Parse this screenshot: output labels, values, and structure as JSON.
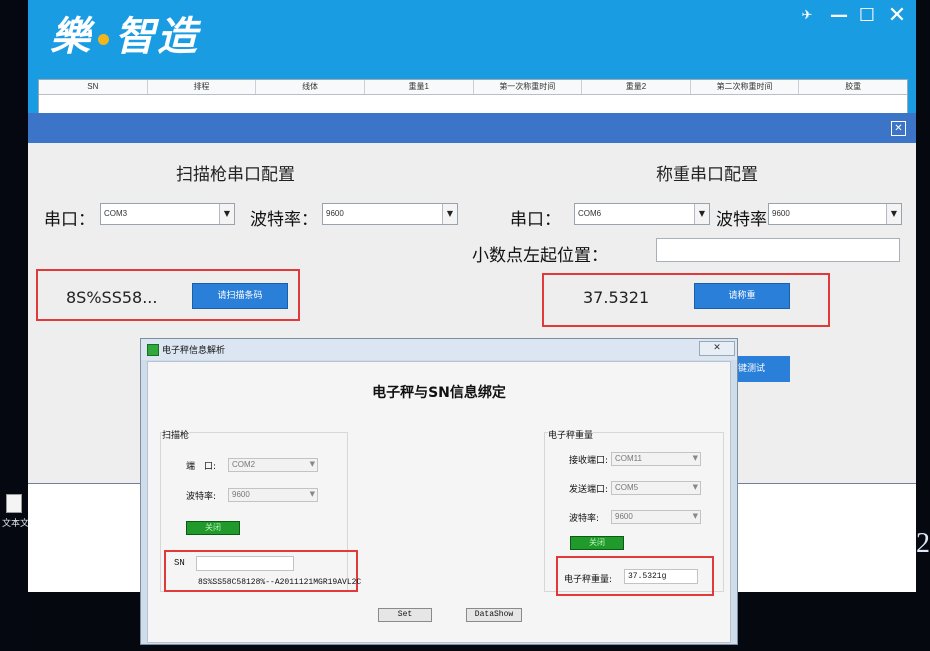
{
  "app": {
    "logo_text_left": "樂",
    "logo_text_right": "智造",
    "window_controls": {
      "pin": "✈",
      "minimize": "—",
      "maximize": "☐",
      "close": "✕"
    }
  },
  "grid": {
    "columns": [
      "SN",
      "排程",
      "线体",
      "重量1",
      "第一次称重时间",
      "重量2",
      "第二次称重时间",
      "胶重"
    ]
  },
  "config": {
    "close_glyph": "✕",
    "scanner": {
      "title": "扫描枪串口配置",
      "port_label": "串口：",
      "port_value": "COM3",
      "baud_label": "波特率：",
      "baud_value": "9600",
      "scan_value": "8S%SS58...",
      "scan_button": "请扫描条码"
    },
    "scale": {
      "title": "称重串口配置",
      "port_label": "串口：",
      "port_value": "COM6",
      "baud_label": "波特率：",
      "baud_value": "9600",
      "decimal_label": "小数点左起位置：",
      "decimal_value": "",
      "weight_value": "37.5321",
      "weigh_button": "请称重"
    },
    "behind_button_fragment": "键测试"
  },
  "dialog": {
    "title": "电子秤信息解析",
    "close_glyph": "✕",
    "heading": "电子秤与SN信息绑定",
    "scanner_group": {
      "title": "扫描枪",
      "port_label": "端　口:",
      "port_value": "COM2",
      "baud_label": "波特率:",
      "baud_value": "9600",
      "toggle_button": "关闭",
      "sn_label": "SN",
      "sn_input": "",
      "sn_value": "8S%SS58C58128%--A2011121MGR19AVL2C"
    },
    "scale_group": {
      "title": "电子秤重量",
      "rx_label": "接收端口:",
      "rx_value": "COM11",
      "tx_label": "发送端口:",
      "tx_value": "COM5",
      "baud_label": "波特率:",
      "baud_value": "9600",
      "toggle_button": "关闭",
      "weight_label": "电子秤重量:",
      "weight_value": "37.5321g"
    },
    "set_button": "Set",
    "datashow_button": "DataShow"
  },
  "desktop": {
    "file_label": "文本文",
    "right_glyph": "2"
  }
}
